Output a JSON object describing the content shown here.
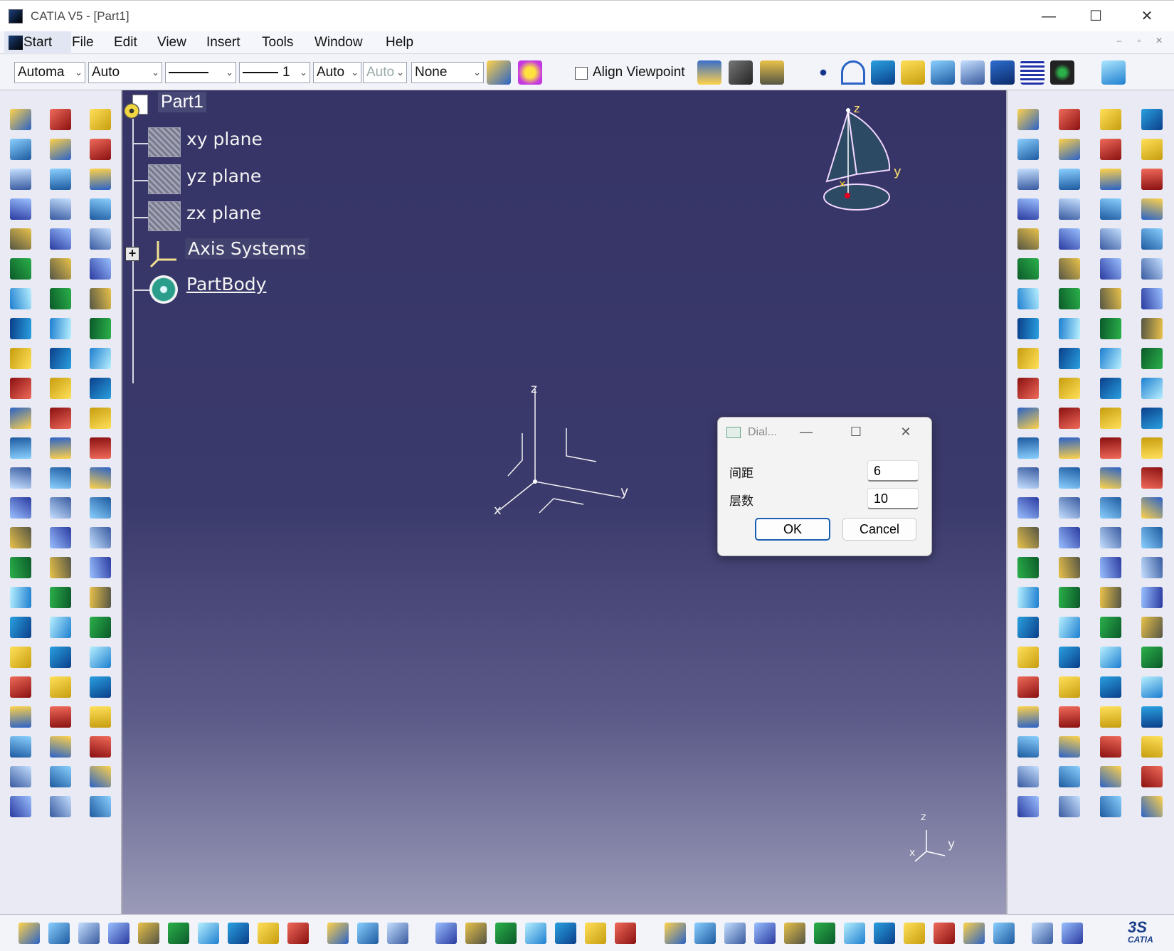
{
  "window": {
    "title": "CATIA V5 - [Part1]"
  },
  "menu": {
    "start": "Start",
    "items": [
      "File",
      "Edit",
      "View",
      "Insert",
      "Tools",
      "Window",
      "Help"
    ]
  },
  "toolbar": {
    "combo_color": "Automa",
    "combo_transparency": "Auto",
    "combo_line_thickness": "1",
    "combo_linetype_value": "Auto",
    "combo_disabled": "Auto",
    "combo_layer": "None",
    "align_viewpoint": "Align Viewpoint"
  },
  "tree": {
    "root": "Part1",
    "items": [
      {
        "label": "xy plane"
      },
      {
        "label": "yz plane"
      },
      {
        "label": "zx plane"
      },
      {
        "label": "Axis Systems"
      },
      {
        "label": "PartBody"
      }
    ]
  },
  "axes": {
    "x": "x",
    "y": "y",
    "z": "z"
  },
  "dialog": {
    "title": "Dial...",
    "fields": [
      {
        "label": "间距",
        "value": "6"
      },
      {
        "label": "层数",
        "value": "10"
      }
    ],
    "ok": "OK",
    "cancel": "Cancel"
  },
  "colors": {
    "viewport_top": "#363466",
    "viewport_bottom": "#9a9ab8",
    "toolbar_bg": "#e9eaf3",
    "accent": "#1a5fb4"
  },
  "branding": {
    "logo": "CATIA"
  }
}
